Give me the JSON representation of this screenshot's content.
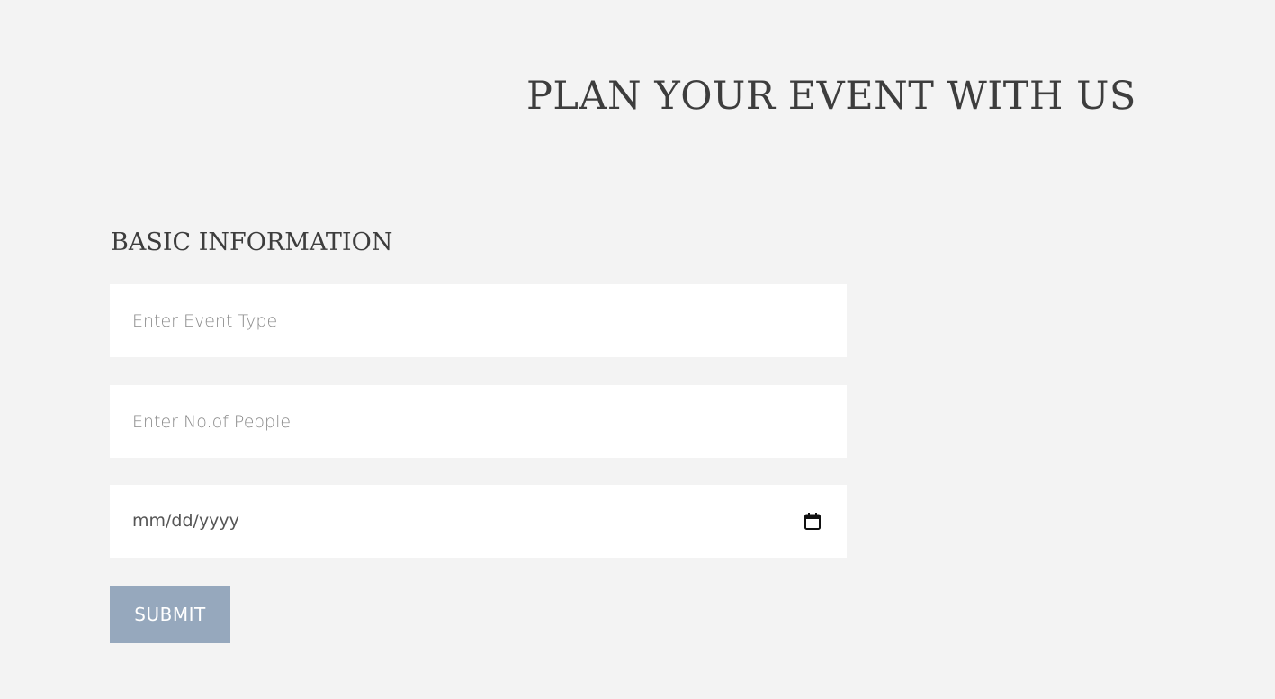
{
  "header": {
    "title": "PLAN YOUR EVENT WITH US"
  },
  "form": {
    "section_heading": "BASIC INFORMATION",
    "event_type": {
      "placeholder": "Enter Event Type",
      "value": ""
    },
    "people": {
      "placeholder": "Enter No.of People",
      "value": ""
    },
    "date": {
      "display": "mm/dd/yyyy",
      "icon": "calendar-icon"
    },
    "submit_label": "SUBMIT"
  },
  "colors": {
    "background": "#f3f3f3",
    "text": "#3d3d3d",
    "field_background": "#ffffff",
    "button": "#96a8bd"
  }
}
